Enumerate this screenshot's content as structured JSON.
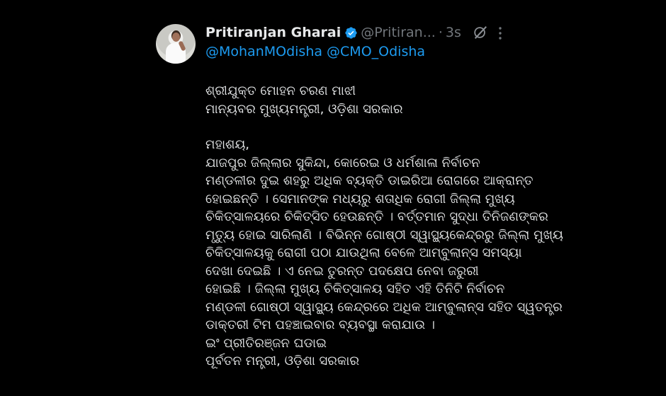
{
  "tweet": {
    "author_name": "Pritiranjan Gharai",
    "handle": "@Pritiran...",
    "separator": "·",
    "time": "3s",
    "mentions": [
      "@MohanMOdisha",
      "@CMO_Odisha"
    ],
    "verified_color": "#1d9bf0",
    "icons": {
      "verified": "verified-badge-icon",
      "grok": "grok-icon",
      "more": "more-vertical-icon"
    },
    "lines": [
      "ଶ୍ରୀଯୁକ୍ତ ମୋହନ ଚରଣ ମାଝୀ",
      "ମାନ୍ୟବର ମୁଖ୍ୟମନ୍ତ୍ରୀ, ଓଡ଼ିଶା ସରକାର",
      "",
      "ମହାଶୟ,",
      "ଯାଜପୁର ଜିଲ୍ଲାର ସୁକିନ୍ଦା, କୋରେଇ ଓ ଧର୍ମଶାଳା ନିର୍ବାଚନ",
      "ମଣ୍ଡଳୀର ଦୁଇ ଶହରୁ ଅଧିକ ବ୍ୟକ୍ତି ଡାଇରିଆ ରୋଗରେ ଆକ୍ରାନ୍ତ",
      "ହୋଇଛନ୍ତି । ସେମାନଙ୍କ ମଧ୍ୟରୁ ଶତାଧିକ ରୋଗୀ ଜିଲ୍ଲା ମୁଖ୍ୟ",
      "ଚିକିତ୍ସାଳୟରେ ଚିକିତ୍ସିତ ହେଉଛନ୍ତି । ବର୍ତ୍ତମାନ ସୁଦ୍ଧା ତିନିଜଣଙ୍କର",
      "ମୃତ୍ୟୁ ହୋଇ ସାରିଲାଣି । ବିଭିନ୍ନ ଗୋଷ୍ଠୀ ସ୍ୱାସ୍ଥ୍ୟକେନ୍ଦ୍ରରୁ ଜିଲ୍ଲା ମୁଖ୍ୟ",
      "ଚିକିତ୍ସାଳୟକୁ ରୋଗୀ ପଠା ଯାଉଥିଲା ବେଳେ ଆମ୍ବୁଲାନ୍ସ ସମସ୍ୟା",
      "ଦେଖା ଦେଇଛି । ଏ ନେଇ ତୁରନ୍ତ ପଦକ୍ଷେପ ନେବା ଜରୁରୀ",
      "ହୋଇଛି । ଜିଲ୍ଲା ମୁଖ୍ୟ ଚିକିତ୍ସାଳୟ ସହିତ ଏହି ତିନିଟି ନିର୍ବାଚନ",
      "ମଣ୍ଡଳୀ ଗୋଷ୍ଠୀ ସ୍ୱାସ୍ଥ୍ୟ କେନ୍ଦ୍ରରେ ଅଧିକ ଆମ୍ବୁଲାନ୍ସ ସହିତ ସ୍ୱତନ୍ତ୍ର",
      "ଡାକ୍ତରୀ ଟିମ ପହଞ୍ଚାଇବାର ବ୍ୟବସ୍ଥା କରାଯାଉ ।",
      "ଇଂ ପ୍ରୀତିରଞ୍ଜନ ଘଡାଇ",
      "ପୂର୍ବତନ ମନ୍ତ୍ରୀ, ଓଡ଼ିଶା ସରକାର"
    ]
  }
}
